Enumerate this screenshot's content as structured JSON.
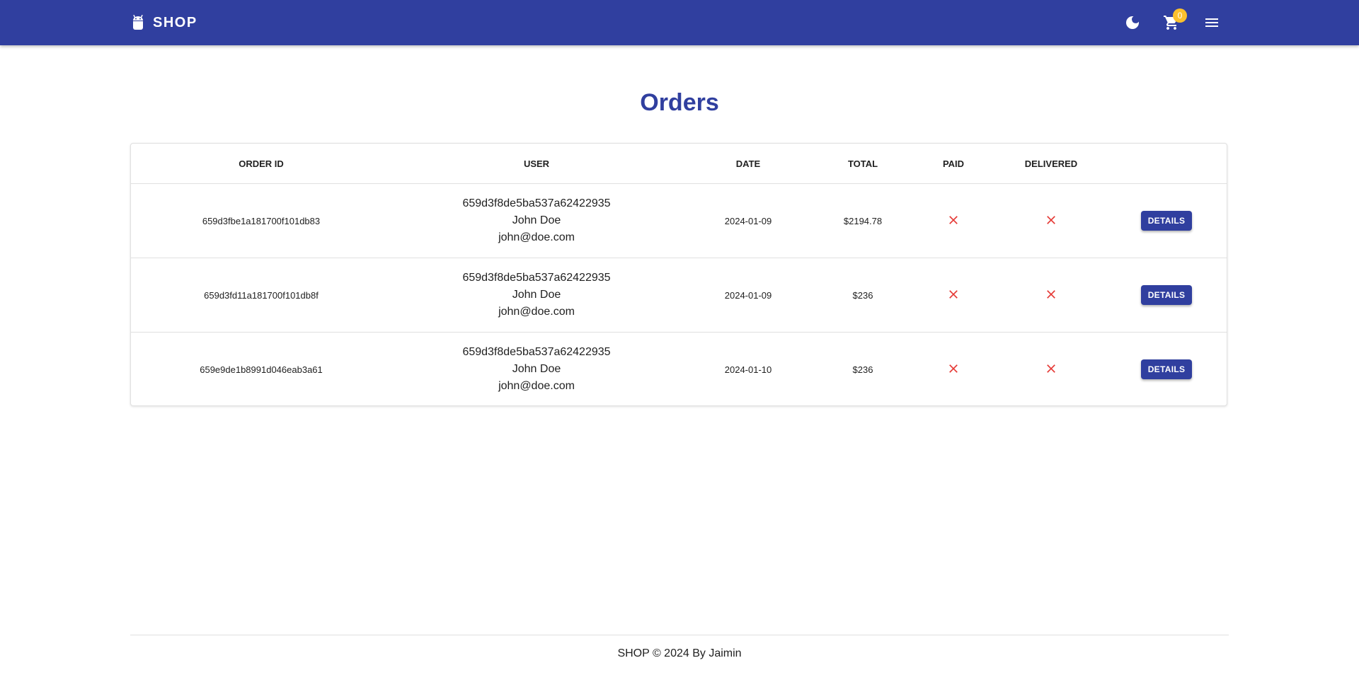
{
  "header": {
    "brand": "SHOP",
    "cart_count": "0",
    "accent": "#303f9f",
    "badge_color": "#fbc02d",
    "icons": [
      "android-icon",
      "dark-mode-icon",
      "cart-icon",
      "menu-icon"
    ]
  },
  "page": {
    "title": "Orders"
  },
  "table": {
    "columns": [
      "ORDER ID",
      "USER",
      "DATE",
      "TOTAL",
      "PAID",
      "DELIVERED",
      ""
    ],
    "rows": [
      {
        "order_id": "659d3fbe1a181700f101db83",
        "user_id": "659d3f8de5ba537a62422935",
        "user_name": "John Doe",
        "user_email": "john@doe.com",
        "date": "2024-01-09",
        "total": "$2194.78",
        "paid": "not-paid",
        "delivered": "not-delivered",
        "action": "DETAILS"
      },
      {
        "order_id": "659d3fd11a181700f101db8f",
        "user_id": "659d3f8de5ba537a62422935",
        "user_name": "John Doe",
        "user_email": "john@doe.com",
        "date": "2024-01-09",
        "total": "$236",
        "paid": "not-paid",
        "delivered": "not-delivered",
        "action": "DETAILS"
      },
      {
        "order_id": "659e9de1b8991d046eab3a61",
        "user_id": "659d3f8de5ba537a62422935",
        "user_name": "John Doe",
        "user_email": "john@doe.com",
        "date": "2024-01-10",
        "total": "$236",
        "paid": "not-paid",
        "delivered": "not-delivered",
        "action": "DETAILS"
      }
    ],
    "status_color": "#e53935"
  },
  "footer": {
    "text": "SHOP © 2024 By Jaimin"
  }
}
